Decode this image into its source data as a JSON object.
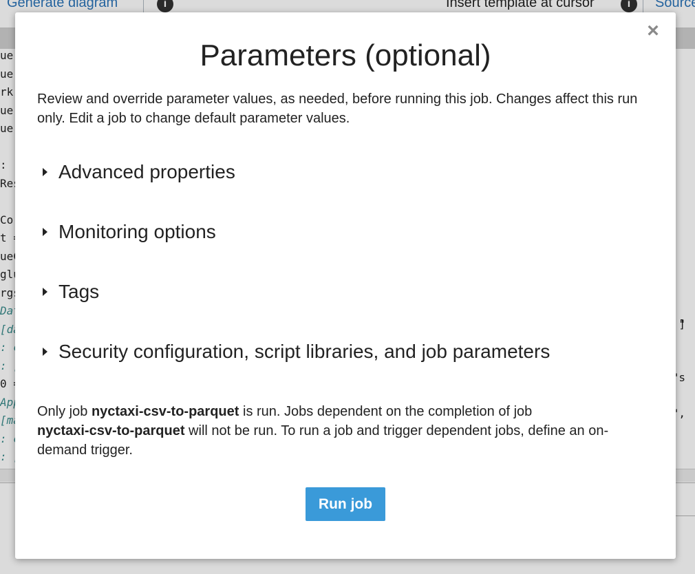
{
  "background": {
    "toolbar": {
      "generate_diagram": "Generate diagram",
      "info": "i",
      "insert_template": "Insert template at cursor",
      "source": "Source"
    },
    "code_fragments": [
      "ue.",
      "ue.",
      "rk.",
      "ue.",
      "ue.",
      "",
      ": [",
      "Res",
      "",
      "Cor",
      "t =",
      "ueC",
      "glu",
      "rgs",
      "Dat",
      "[da",
      ": c",
      ": [",
      "0 =",
      "App",
      "[ma",
      ": c",
      ": ["
    ],
    "code_right": [
      "]",
      "\"s",
      "\",",
      "\"",
      "..."
    ]
  },
  "modal": {
    "title": "Parameters (optional)",
    "close_label": "×",
    "description": "Review and override parameter values, as needed, before running this job. Changes affect this run only. Edit a job to change default parameter values.",
    "sections": [
      {
        "label": "Advanced properties"
      },
      {
        "label": "Monitoring options"
      },
      {
        "label": "Tags"
      },
      {
        "label": "Security configuration, script libraries, and job parameters"
      }
    ],
    "note": {
      "part1": "Only job ",
      "job_name_1": "nyctaxi-csv-to-parquet",
      "part2": " is run. Jobs dependent on the completion of job ",
      "job_name_2": "nyctaxi-csv-to-parquet",
      "part3": " will not be run. To run a job and trigger dependent jobs, define an on-demand trigger."
    },
    "run_button": "Run job"
  },
  "colors": {
    "primary_button": "#3a9ad9",
    "link_blue": "#2b74b8",
    "overlay": "rgba(0,0,0,0.14)"
  }
}
